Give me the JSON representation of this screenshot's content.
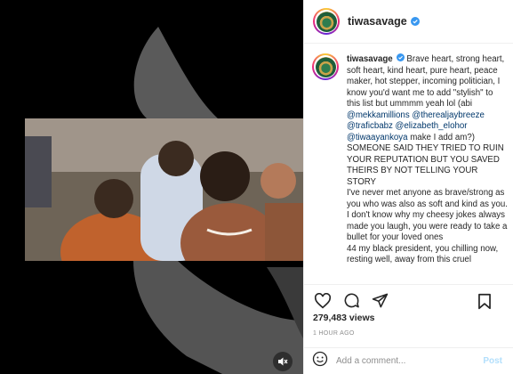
{
  "post": {
    "username": "tiwasavage",
    "verified": true,
    "caption_username": "tiwasavage",
    "caption_part1": " Brave heart, strong heart, soft heart, kind heart, pure heart, peace maker, hot stepper, incoming politician, I know you'd want me to add \"stylish\" to this list but ummmm yeah lol (abi ",
    "mentions": [
      "@mekkamillions",
      "@therealjaybreeze",
      "@traficbabz",
      "@elizabeth_elohor",
      "@tiwaayankoya"
    ],
    "caption_part2": " make I add am?)\nSOMEONE SAID THEY TRIED TO RUIN YOUR REPUTATION BUT YOU SAVED THEIRS BY NOT TELLING YOUR STORY\nI've never met anyone as brave/strong as you who was also as soft and kind as you. I don't know why my cheesy jokes always made you laugh, you were ready to take a bullet for your loved ones\n44 my black president, you chilling now, resting well, away from this cruel",
    "views": "279,483 views",
    "time": "1 HOUR AGO"
  },
  "comment": {
    "placeholder": "Add a comment...",
    "post_label": "Post"
  },
  "icons": {
    "like": "heart-icon",
    "comment": "comment-icon",
    "share": "share-icon",
    "save": "bookmark-icon",
    "emoji": "emoji-icon",
    "mute": "mute-icon",
    "verified": "verified-badge-icon"
  },
  "colors": {
    "verified": "#3897f0",
    "mention": "#00376b",
    "post_disabled": "#b2dffc"
  }
}
